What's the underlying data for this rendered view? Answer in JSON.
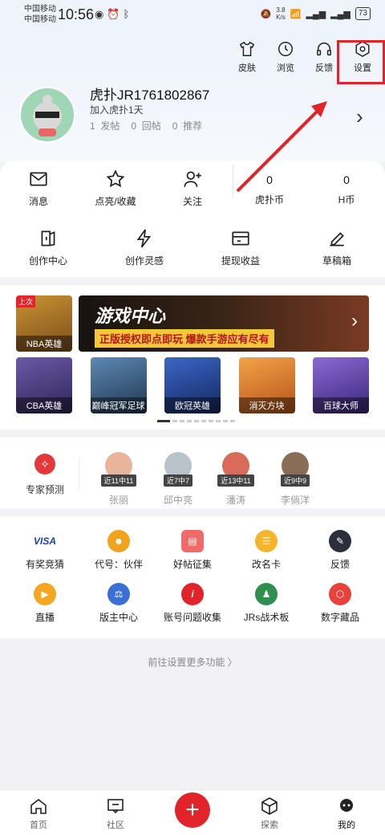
{
  "status_bar": {
    "carrier1": "中国移动",
    "carrier2": "中国移动",
    "time": "10:56",
    "speed_value": "3.8",
    "speed_unit": "K/s",
    "battery": "73"
  },
  "top_actions": [
    {
      "label": "皮肤",
      "icon": "shirt-icon"
    },
    {
      "label": "浏览",
      "icon": "clock-icon"
    },
    {
      "label": "反馈",
      "icon": "headset-icon"
    },
    {
      "label": "设置",
      "icon": "settings-icon"
    }
  ],
  "profile": {
    "username": "虎扑JR1761802867",
    "joined": "加入虎扑1天",
    "posts_count": "1",
    "posts_label": "发帖",
    "replies_count": "0",
    "replies_label": "回帖",
    "recommends_count": "0",
    "recommends_label": "推荐"
  },
  "quick_row": {
    "messages": "消息",
    "likes": "点亮/收藏",
    "follow": "关注",
    "hupu_coin_value": "0",
    "hupu_coin_label": "虎扑币",
    "h_coin_value": "0",
    "h_coin_label": "H币"
  },
  "creator_row": [
    {
      "label": "创作中心",
      "icon": "creator-center-icon"
    },
    {
      "label": "创作灵感",
      "icon": "lightning-icon"
    },
    {
      "label": "提现收益",
      "icon": "wallet-icon"
    },
    {
      "label": "草稿箱",
      "icon": "edit-icon"
    }
  ],
  "game_center": {
    "last_badge": "上次",
    "last_game": "NBA英雄",
    "banner_title": "游戏中心",
    "banner_sub": "正版授权即点即玩 爆款手游应有尽有",
    "games": [
      {
        "label": "CBA英雄",
        "color": "#4a3a78"
      },
      {
        "label": "巅峰冠军足球",
        "color": "#2c4a6b"
      },
      {
        "label": "欧冠英雄",
        "color": "#1e3f8a"
      },
      {
        "label": "消灭方块",
        "color": "#d8782f"
      },
      {
        "label": "百球大师",
        "color": "#5a3f9a"
      }
    ]
  },
  "experts": {
    "main_label": "专家预测",
    "list": [
      {
        "tag": "近11中11",
        "name": "张丽"
      },
      {
        "tag": "近7中7",
        "name": "邱中亮"
      },
      {
        "tag": "近13中11",
        "name": "潘涛"
      },
      {
        "tag": "近9中9",
        "name": "李倘洋"
      }
    ]
  },
  "tools": {
    "row1": [
      {
        "label": "有奖竞猜",
        "glyph": "VISA",
        "color": "#ffffff",
        "text_color": "#1a3fa8"
      },
      {
        "label": "代号：伙伴",
        "glyph": "☻",
        "color": "#f0a41e",
        "text_color": "#ffffff"
      },
      {
        "label": "好帖征集",
        "glyph": "▤",
        "color": "#f06a6a",
        "text_color": "#ffffff"
      },
      {
        "label": "改名卡",
        "glyph": "☰",
        "color": "#f5b52a",
        "text_color": "#ffffff"
      },
      {
        "label": "反馈",
        "glyph": "✎",
        "color": "#2b2f3a",
        "text_color": "#ffffff"
      }
    ],
    "row2": [
      {
        "label": "直播",
        "glyph": "▶",
        "color": "#f5a623",
        "text_color": "#ffffff"
      },
      {
        "label": "版主中心",
        "glyph": "⚖",
        "color": "#3c6fd6",
        "text_color": "#ffffff"
      },
      {
        "label": "账号问题收集",
        "glyph": "i",
        "color": "#e0242a",
        "text_color": "#ffffff"
      },
      {
        "label": "JRs战术板",
        "glyph": "♟",
        "color": "#2f8f4f",
        "text_color": "#ffffff"
      },
      {
        "label": "数字藏品",
        "glyph": "⬡",
        "color": "#e8423a",
        "text_color": "#ffffff"
      }
    ]
  },
  "more_settings": "前往设置更多功能 〉",
  "bottom_nav": [
    {
      "label": "首页",
      "icon": "home-icon"
    },
    {
      "label": "社区",
      "icon": "community-icon"
    },
    {
      "label": "探索",
      "icon": "explore-icon"
    },
    {
      "label": "我的",
      "icon": "profile-icon"
    }
  ],
  "accent_color": "#e0242a"
}
